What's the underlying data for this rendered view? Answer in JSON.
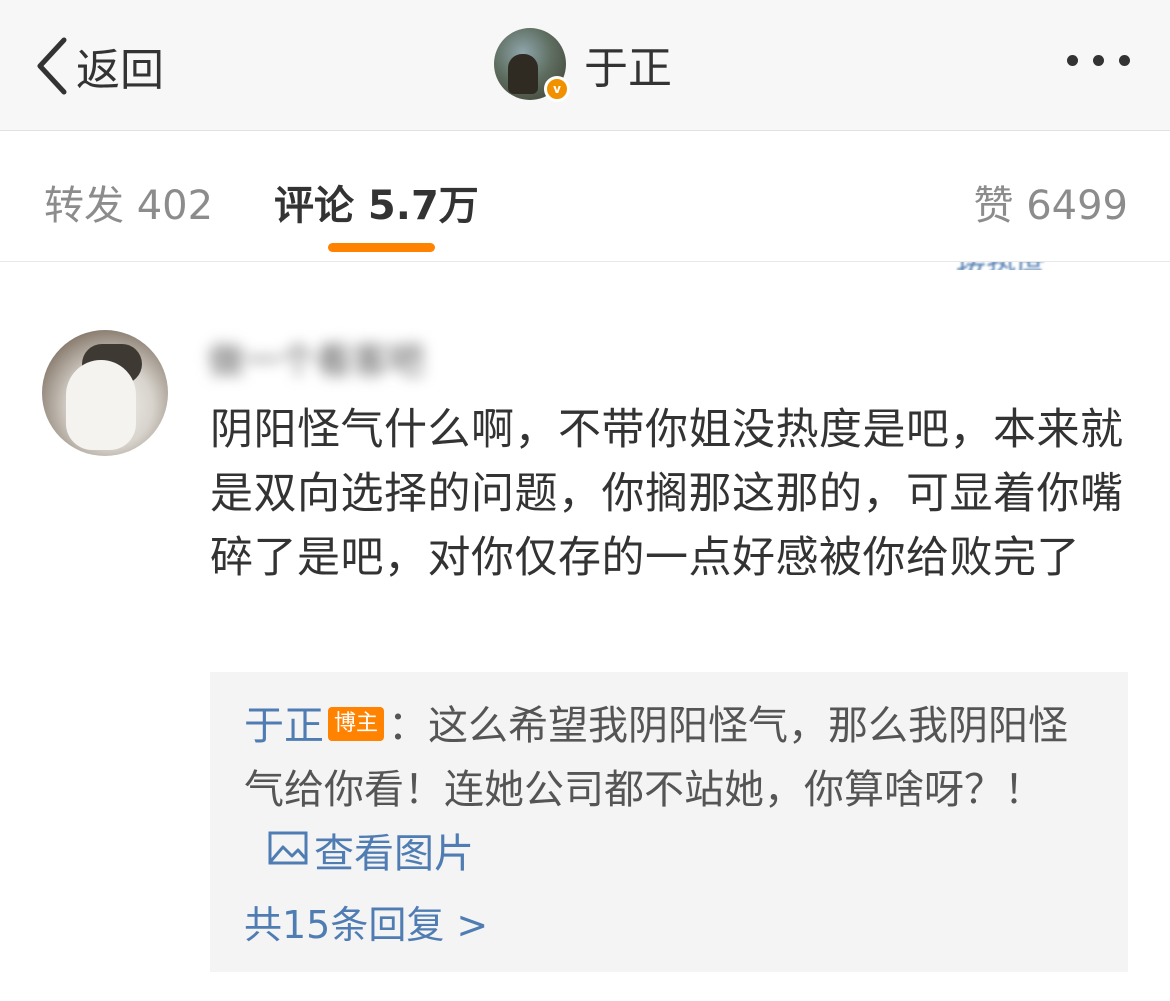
{
  "header": {
    "back_label": "返回",
    "account_name": "于正"
  },
  "tabs": {
    "repost": "转发 402",
    "comment": "评论 5.7万",
    "like": "赞 6499",
    "sort_label": "按热度"
  },
  "comment": {
    "username": "做一个看客吧",
    "text": "阴阳怪气什么啊，不带你姐没热度是吧，本来就是双向选择的问题，你搁那这那的，可显着你嘴碎了是吧，对你仅存的一点好感被你给败完了"
  },
  "reply": {
    "author": "于正",
    "badge": "博主",
    "text": "：这么希望我阴阳怪气，那么我阴阳怪气给你看！连她公司都不站她，你算啥呀？！",
    "view_picture": "查看图片",
    "more_replies": "共15条回复 >"
  },
  "colors": {
    "accent": "#ff8200",
    "link": "#4f7db3"
  }
}
